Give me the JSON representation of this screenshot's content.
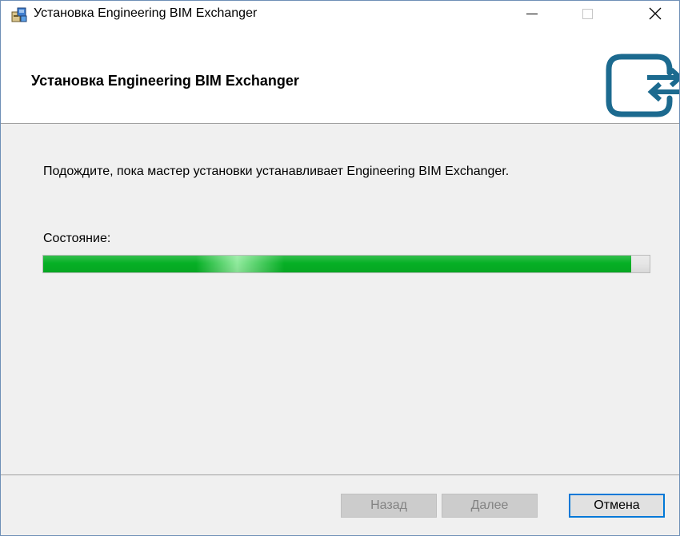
{
  "window": {
    "title": "Установка Engineering BIM Exchanger",
    "controls": {
      "minimize": "minimize",
      "maximize": "maximize",
      "close": "close"
    }
  },
  "banner": {
    "title": "Установка Engineering BIM Exchanger",
    "logo_icon": "exchange-arrows-icon"
  },
  "content": {
    "message": "Подождите, пока мастер установки устанавливает Engineering BIM Exchanger.",
    "status_label": "Состояние:",
    "progress": {
      "value_percent": 97
    }
  },
  "buttons": {
    "back": "Назад",
    "next": "Далее",
    "cancel": "Отмена"
  },
  "colors": {
    "accent": "#0078d7",
    "progress_fill": "#06b025",
    "logo": "#1c6a8f"
  }
}
